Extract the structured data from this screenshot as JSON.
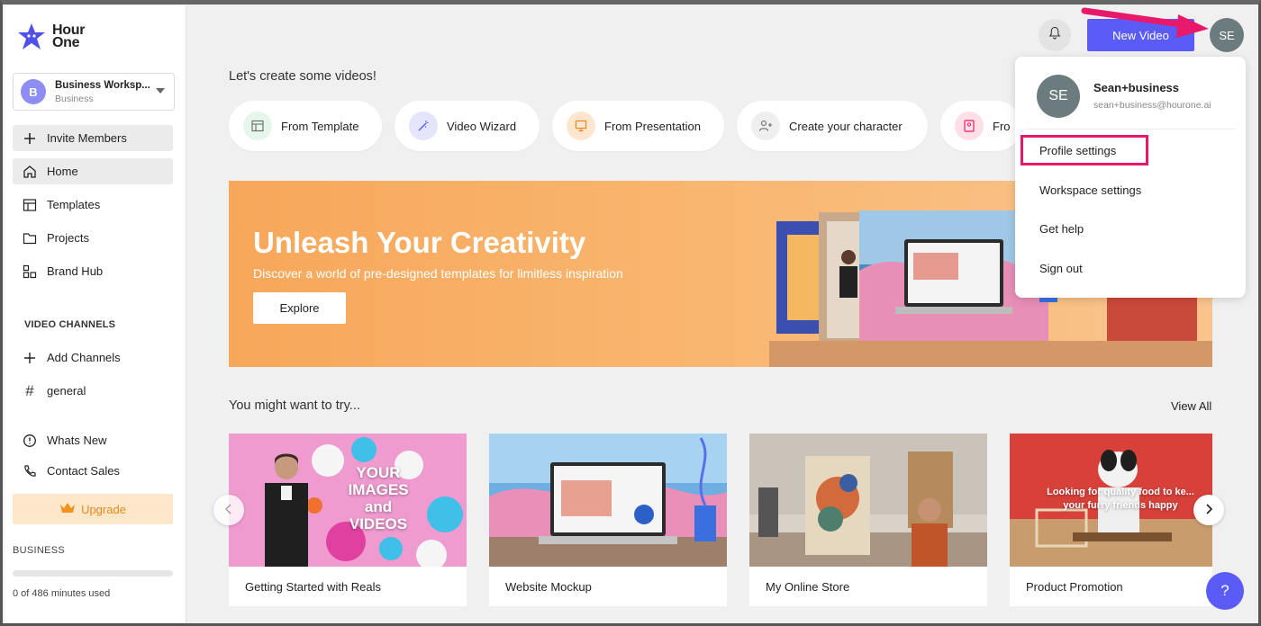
{
  "logo": {
    "line1": "Hour",
    "line2": "One"
  },
  "workspace": {
    "initial": "B",
    "name": "Business Worksp...",
    "plan": "Business"
  },
  "sidebar": {
    "items": [
      {
        "label": "Invite Members",
        "icon": "plus-icon"
      },
      {
        "label": "Home",
        "icon": "home-icon"
      },
      {
        "label": "Templates",
        "icon": "templates-icon"
      },
      {
        "label": "Projects",
        "icon": "folder-icon"
      },
      {
        "label": "Brand Hub",
        "icon": "brand-hub-icon"
      }
    ],
    "channels_label": "VIDEO CHANNELS",
    "channels": [
      {
        "label": "Add Channels",
        "icon": "plus-icon"
      },
      {
        "label": "general",
        "icon": "hash-icon"
      }
    ],
    "bottom_items": [
      {
        "label": "Whats New",
        "icon": "gift-icon"
      },
      {
        "label": "Contact Sales",
        "icon": "phone-icon"
      }
    ],
    "upgrade_label": "Upgrade",
    "plan_label": "BUSINESS",
    "usage_text": "0 of 486 minutes used",
    "usage_fraction": 0
  },
  "topbar": {
    "new_video_label": "New Video",
    "avatar_initials": "SE"
  },
  "main": {
    "greeting": "Let's create some videos!",
    "quick_actions": [
      {
        "label": "From Template",
        "icon": "template-icon",
        "color": "#e6f6ea"
      },
      {
        "label": "Video Wizard",
        "icon": "wand-icon",
        "color": "#e4e4fb"
      },
      {
        "label": "From Presentation",
        "icon": "presentation-icon",
        "color": "#fde6cf"
      },
      {
        "label": "Create your character",
        "icon": "add-person-icon",
        "color": "#efefef"
      },
      {
        "label": "Fro",
        "icon": "portrait-icon",
        "color": "#fde0e6"
      }
    ],
    "banner": {
      "title": "Unleash Your Creativity",
      "subtitle": "Discover a world of pre-designed templates for limitless inspiration",
      "button_label": "Explore"
    },
    "try_title": "You might want to try...",
    "view_all_label": "View All",
    "cards": [
      {
        "title": "Getting Started with Reals",
        "thumb_text": "YOUR IMAGES and VIDEOS"
      },
      {
        "title": "Website Mockup"
      },
      {
        "title": "My Online Store"
      },
      {
        "title": "Product Promotion",
        "thumb_text": "Looking for quality food to ke... your furry friends happy"
      }
    ],
    "help_label": "?"
  },
  "profile_menu": {
    "avatar_initials": "SE",
    "name": "Sean+business",
    "email": "sean+business@hourone.ai",
    "items": [
      "Profile settings",
      "Workspace settings",
      "Get help",
      "Sign out"
    ]
  },
  "colors": {
    "accent": "#5b5bf7",
    "highlight": "#e8196a",
    "upgrade_text": "#e8891a"
  }
}
